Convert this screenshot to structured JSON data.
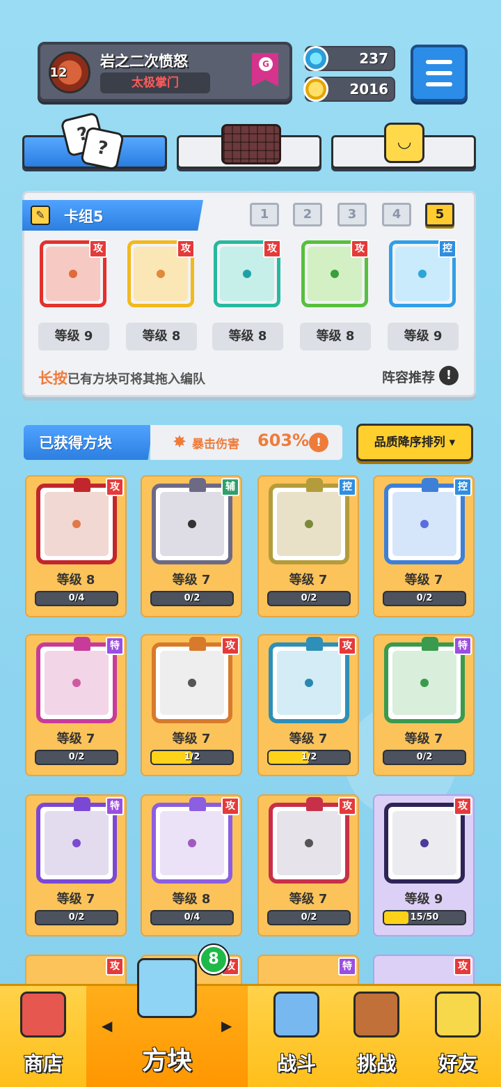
{
  "header": {
    "player_name": "岩之二次愤怒",
    "player_title": "太极掌门",
    "avatar_level": "12",
    "rank_badge": "G",
    "gems": "237",
    "coins": "2016"
  },
  "deck": {
    "title": "卡组5",
    "slots": [
      "1",
      "2",
      "3",
      "4",
      "5"
    ],
    "active_slot": "5",
    "cards": [
      {
        "level": "等级 9",
        "tag": "攻",
        "tag_type": "atk",
        "color": "#e3312b",
        "bg": "#f7c9c3",
        "dot": "#e06a3a"
      },
      {
        "level": "等级 8",
        "tag": "攻",
        "tag_type": "atk",
        "color": "#f2b91c",
        "bg": "#fbe6b6",
        "dot": "#e08a3a"
      },
      {
        "level": "等级 8",
        "tag": "攻",
        "tag_type": "atk",
        "color": "#25b9a0",
        "bg": "#c5efe8",
        "dot": "#1fa0a8"
      },
      {
        "level": "等级 8",
        "tag": "攻",
        "tag_type": "atk",
        "color": "#56c03c",
        "bg": "#d2f0c4",
        "dot": "#3a9f3a"
      },
      {
        "level": "等级 9",
        "tag": "控",
        "tag_type": "ctl",
        "color": "#2f9fe8",
        "bg": "#c9ebfb",
        "dot": "#2aa6d8"
      }
    ],
    "hint_strong": "长按",
    "hint_text": "已有方块可将其拖入编队",
    "recommend": "阵容推荐"
  },
  "acquired": {
    "title": "已获得方块",
    "crit_label": "暴击伤害",
    "crit_value": "603%",
    "sort_label": "品质降序排列 ▾",
    "cubes": [
      {
        "level": "等级 8",
        "progress": "0/4",
        "fill": 0,
        "tag": "攻",
        "tag_type": "atk",
        "frame": "#c2262d",
        "bg": "#f2d8d2",
        "dot": "#e07a4a"
      },
      {
        "level": "等级 7",
        "progress": "0/2",
        "fill": 0,
        "tag": "辅",
        "tag_type": "sup",
        "frame": "#6d6a86",
        "bg": "#dedde6",
        "dot": "#333333"
      },
      {
        "level": "等级 7",
        "progress": "0/2",
        "fill": 0,
        "tag": "控",
        "tag_type": "ctl",
        "frame": "#b49c3c",
        "bg": "#e8e1c8",
        "dot": "#7a8a3a"
      },
      {
        "level": "等级 7",
        "progress": "0/2",
        "fill": 0,
        "tag": "控",
        "tag_type": "ctl",
        "frame": "#3e7fd8",
        "bg": "#d6e6fa",
        "dot": "#5a6ee0"
      },
      {
        "level": "等级 7",
        "progress": "0/2",
        "fill": 0,
        "tag": "特",
        "tag_type": "spc",
        "frame": "#c83b9a",
        "bg": "#f3d5e8",
        "dot": "#d05aa0"
      },
      {
        "level": "等级 7",
        "progress": "1/2",
        "fill": 0.5,
        "tag": "攻",
        "tag_type": "atk",
        "frame": "#d77a2c",
        "bg": "#eeeeee",
        "dot": "#555555"
      },
      {
        "level": "等级 7",
        "progress": "1/2",
        "fill": 0.5,
        "tag": "攻",
        "tag_type": "atk",
        "frame": "#2e8fb8",
        "bg": "#d3ecf5",
        "dot": "#2a88b0"
      },
      {
        "level": "等级 7",
        "progress": "0/2",
        "fill": 0,
        "tag": "特",
        "tag_type": "spc",
        "frame": "#3a9a4e",
        "bg": "#d9eedb",
        "dot": "#3a9a4e"
      },
      {
        "level": "等级 7",
        "progress": "0/2",
        "fill": 0,
        "tag": "特",
        "tag_type": "spc",
        "frame": "#7b48d6",
        "bg": "#e3dcef",
        "dot": "#7a4ad0"
      },
      {
        "level": "等级 8",
        "progress": "0/4",
        "fill": 0,
        "tag": "攻",
        "tag_type": "atk",
        "frame": "#8c5ee0",
        "bg": "#ebe2f7",
        "dot": "#a05abe"
      },
      {
        "level": "等级 7",
        "progress": "0/2",
        "fill": 0,
        "tag": "攻",
        "tag_type": "atk",
        "frame": "#c8304a",
        "bg": "#e6e3ea",
        "dot": "#555555"
      },
      {
        "level": "等级 9",
        "progress": "15/50",
        "fill": 0.3,
        "tag": "攻",
        "tag_type": "atk",
        "frame": "#2e2456",
        "bg": "#ecebf0",
        "dot": "#4a3a9a",
        "legend": true
      }
    ],
    "partial_tags": [
      {
        "tag": "攻",
        "tag_type": "atk"
      },
      {
        "tag": "攻",
        "tag_type": "atk"
      },
      {
        "tag": "特",
        "tag_type": "spc"
      },
      {
        "tag": "攻",
        "tag_type": "atk"
      }
    ]
  },
  "nav": {
    "shop": "商店",
    "cubes": "方块",
    "battle": "战斗",
    "challenge": "挑战",
    "friends": "好友",
    "cubes_badge": "8"
  },
  "colors": {
    "accent_blue": "#2d7fe0",
    "accent_yellow": "#ffcb2e",
    "crit_orange": "#ef7b3a"
  }
}
